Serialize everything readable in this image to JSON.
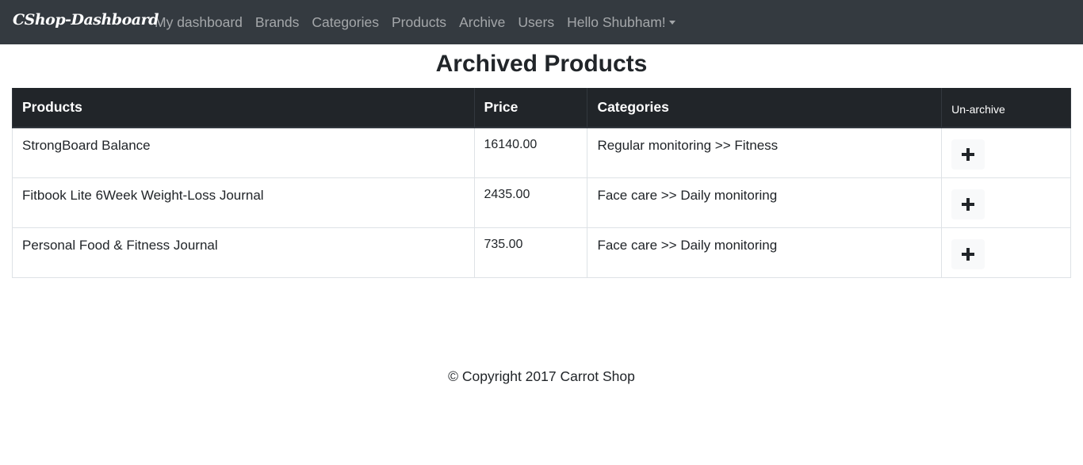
{
  "navbar": {
    "brand": "CShop-Dashboard",
    "links": [
      {
        "label": "My dashboard"
      },
      {
        "label": "Brands"
      },
      {
        "label": "Categories"
      },
      {
        "label": "Products"
      },
      {
        "label": "Archive"
      },
      {
        "label": "Users"
      }
    ],
    "user_menu": "Hello Shubham!"
  },
  "page": {
    "title": "Archived Products"
  },
  "table": {
    "headers": {
      "products": "Products",
      "price": "Price",
      "categories": "Categories",
      "unarchive": "Un-archive"
    },
    "rows": [
      {
        "product": "StrongBoard Balance",
        "price": "16140.00",
        "category": "Regular monitoring >> Fitness",
        "action_icon": "plus-icon"
      },
      {
        "product": "Fitbook Lite 6Week Weight-Loss Journal",
        "price": "2435.00",
        "category": "Face care >> Daily monitoring",
        "action_icon": "plus-icon"
      },
      {
        "product": "Personal Food & Fitness Journal",
        "price": "735.00",
        "category": "Face care >> Daily monitoring",
        "action_icon": "plus-icon"
      }
    ]
  },
  "footer": {
    "text": "© Copyright 2017 Carrot Shop"
  },
  "colors": {
    "navbar_bg": "#343a40",
    "table_header_bg": "#212529",
    "button_bg": "#f8f9fa"
  }
}
